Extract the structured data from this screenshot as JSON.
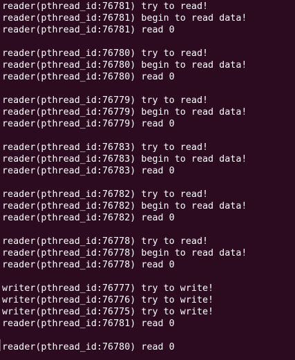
{
  "terminal": {
    "lines": [
      "reader(pthread_id:76781) try to read!",
      "reader(pthread_id:76781) begin to read data!",
      "reader(pthread_id:76781) read 0",
      "",
      "reader(pthread_id:76780) try to read!",
      "reader(pthread_id:76780) begin to read data!",
      "reader(pthread_id:76780) read 0",
      "",
      "reader(pthread_id:76779) try to read!",
      "reader(pthread_id:76779) begin to read data!",
      "reader(pthread_id:76779) read 0",
      "",
      "reader(pthread_id:76783) try to read!",
      "reader(pthread_id:76783) begin to read data!",
      "reader(pthread_id:76783) read 0",
      "",
      "reader(pthread_id:76782) try to read!",
      "reader(pthread_id:76782) begin to read data!",
      "reader(pthread_id:76782) read 0",
      "",
      "reader(pthread_id:76778) try to read!",
      "reader(pthread_id:76778) begin to read data!",
      "reader(pthread_id:76778) read 0",
      "",
      "writer(pthread_id:76777) try to write!",
      "writer(pthread_id:76776) try to write!",
      "writer(pthread_id:76775) try to write!",
      "reader(pthread_id:76781) read 0",
      "",
      "reader(pthread_id:76780) read 0"
    ]
  }
}
